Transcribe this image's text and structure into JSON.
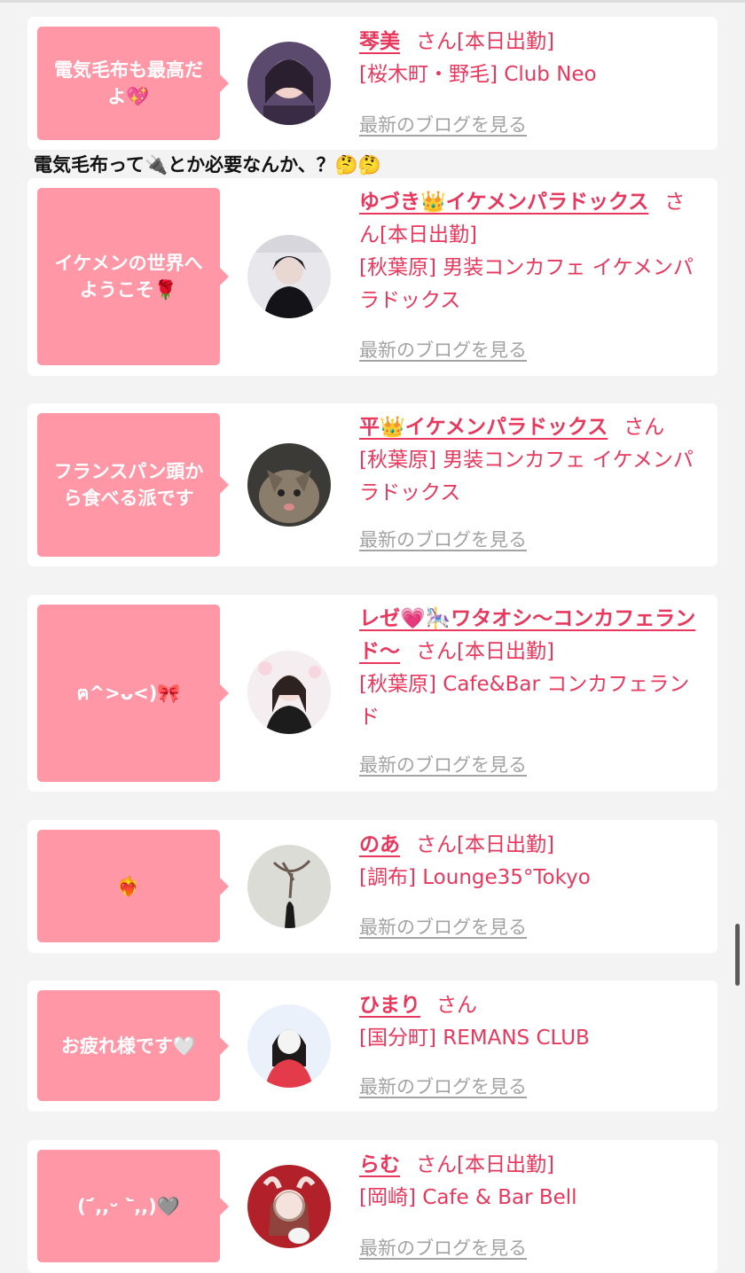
{
  "colors": {
    "accent": "#e8385d",
    "bubble": "#ff97a7",
    "link_gray": "#a3a3a3",
    "background": "#f3f3f3"
  },
  "blog_link_label": "最新のブログを見る",
  "comment_between": "電気毛布って🔌とか必要なんか、？🤔🤔",
  "entries": [
    {
      "bubble": "電気毛布も最高だよ💖",
      "name": "琴美",
      "suffix": "さん[本日出勤]",
      "shop": "[桜木町・野毛] Club Neo"
    },
    {
      "bubble": "イケメンの世界へようこそ🌹",
      "name": "ゆづき👑イケメンパラドックス",
      "suffix": "さん[本日出勤]",
      "shop": "[秋葉原] 男装コンカフェ イケメンパラドックス"
    },
    {
      "bubble": "フランスパン頭から食べる派です",
      "name": "平👑イケメンパラドックス",
      "suffix": "さん",
      "shop": "[秋葉原] 男装コンカフェ イケメンパラドックス"
    },
    {
      "bubble": "ฅ^>ᴗ<)🎀",
      "name": "レゼ💗🎠ワタオシ〜コンカフェランド〜",
      "suffix": "さん[本日出勤]",
      "shop": "[秋葉原] Cafe&Bar コンカフェランド"
    },
    {
      "bubble": "❤️‍🔥",
      "name": "のあ",
      "suffix": "さん[本日出勤]",
      "shop": "[調布] Lounge35°Tokyo"
    },
    {
      "bubble": "お疲れ様です🤍",
      "name": "ひまり",
      "suffix": "さん",
      "shop": "[国分町] REMANS CLUB"
    },
    {
      "bubble": "(ˊ᷄,,ᵕ ˋ᷅,,)🩶",
      "name": "らむ",
      "suffix": "さん[本日出勤]",
      "shop": "[岡崎] Cafe & Bar Bell"
    }
  ]
}
